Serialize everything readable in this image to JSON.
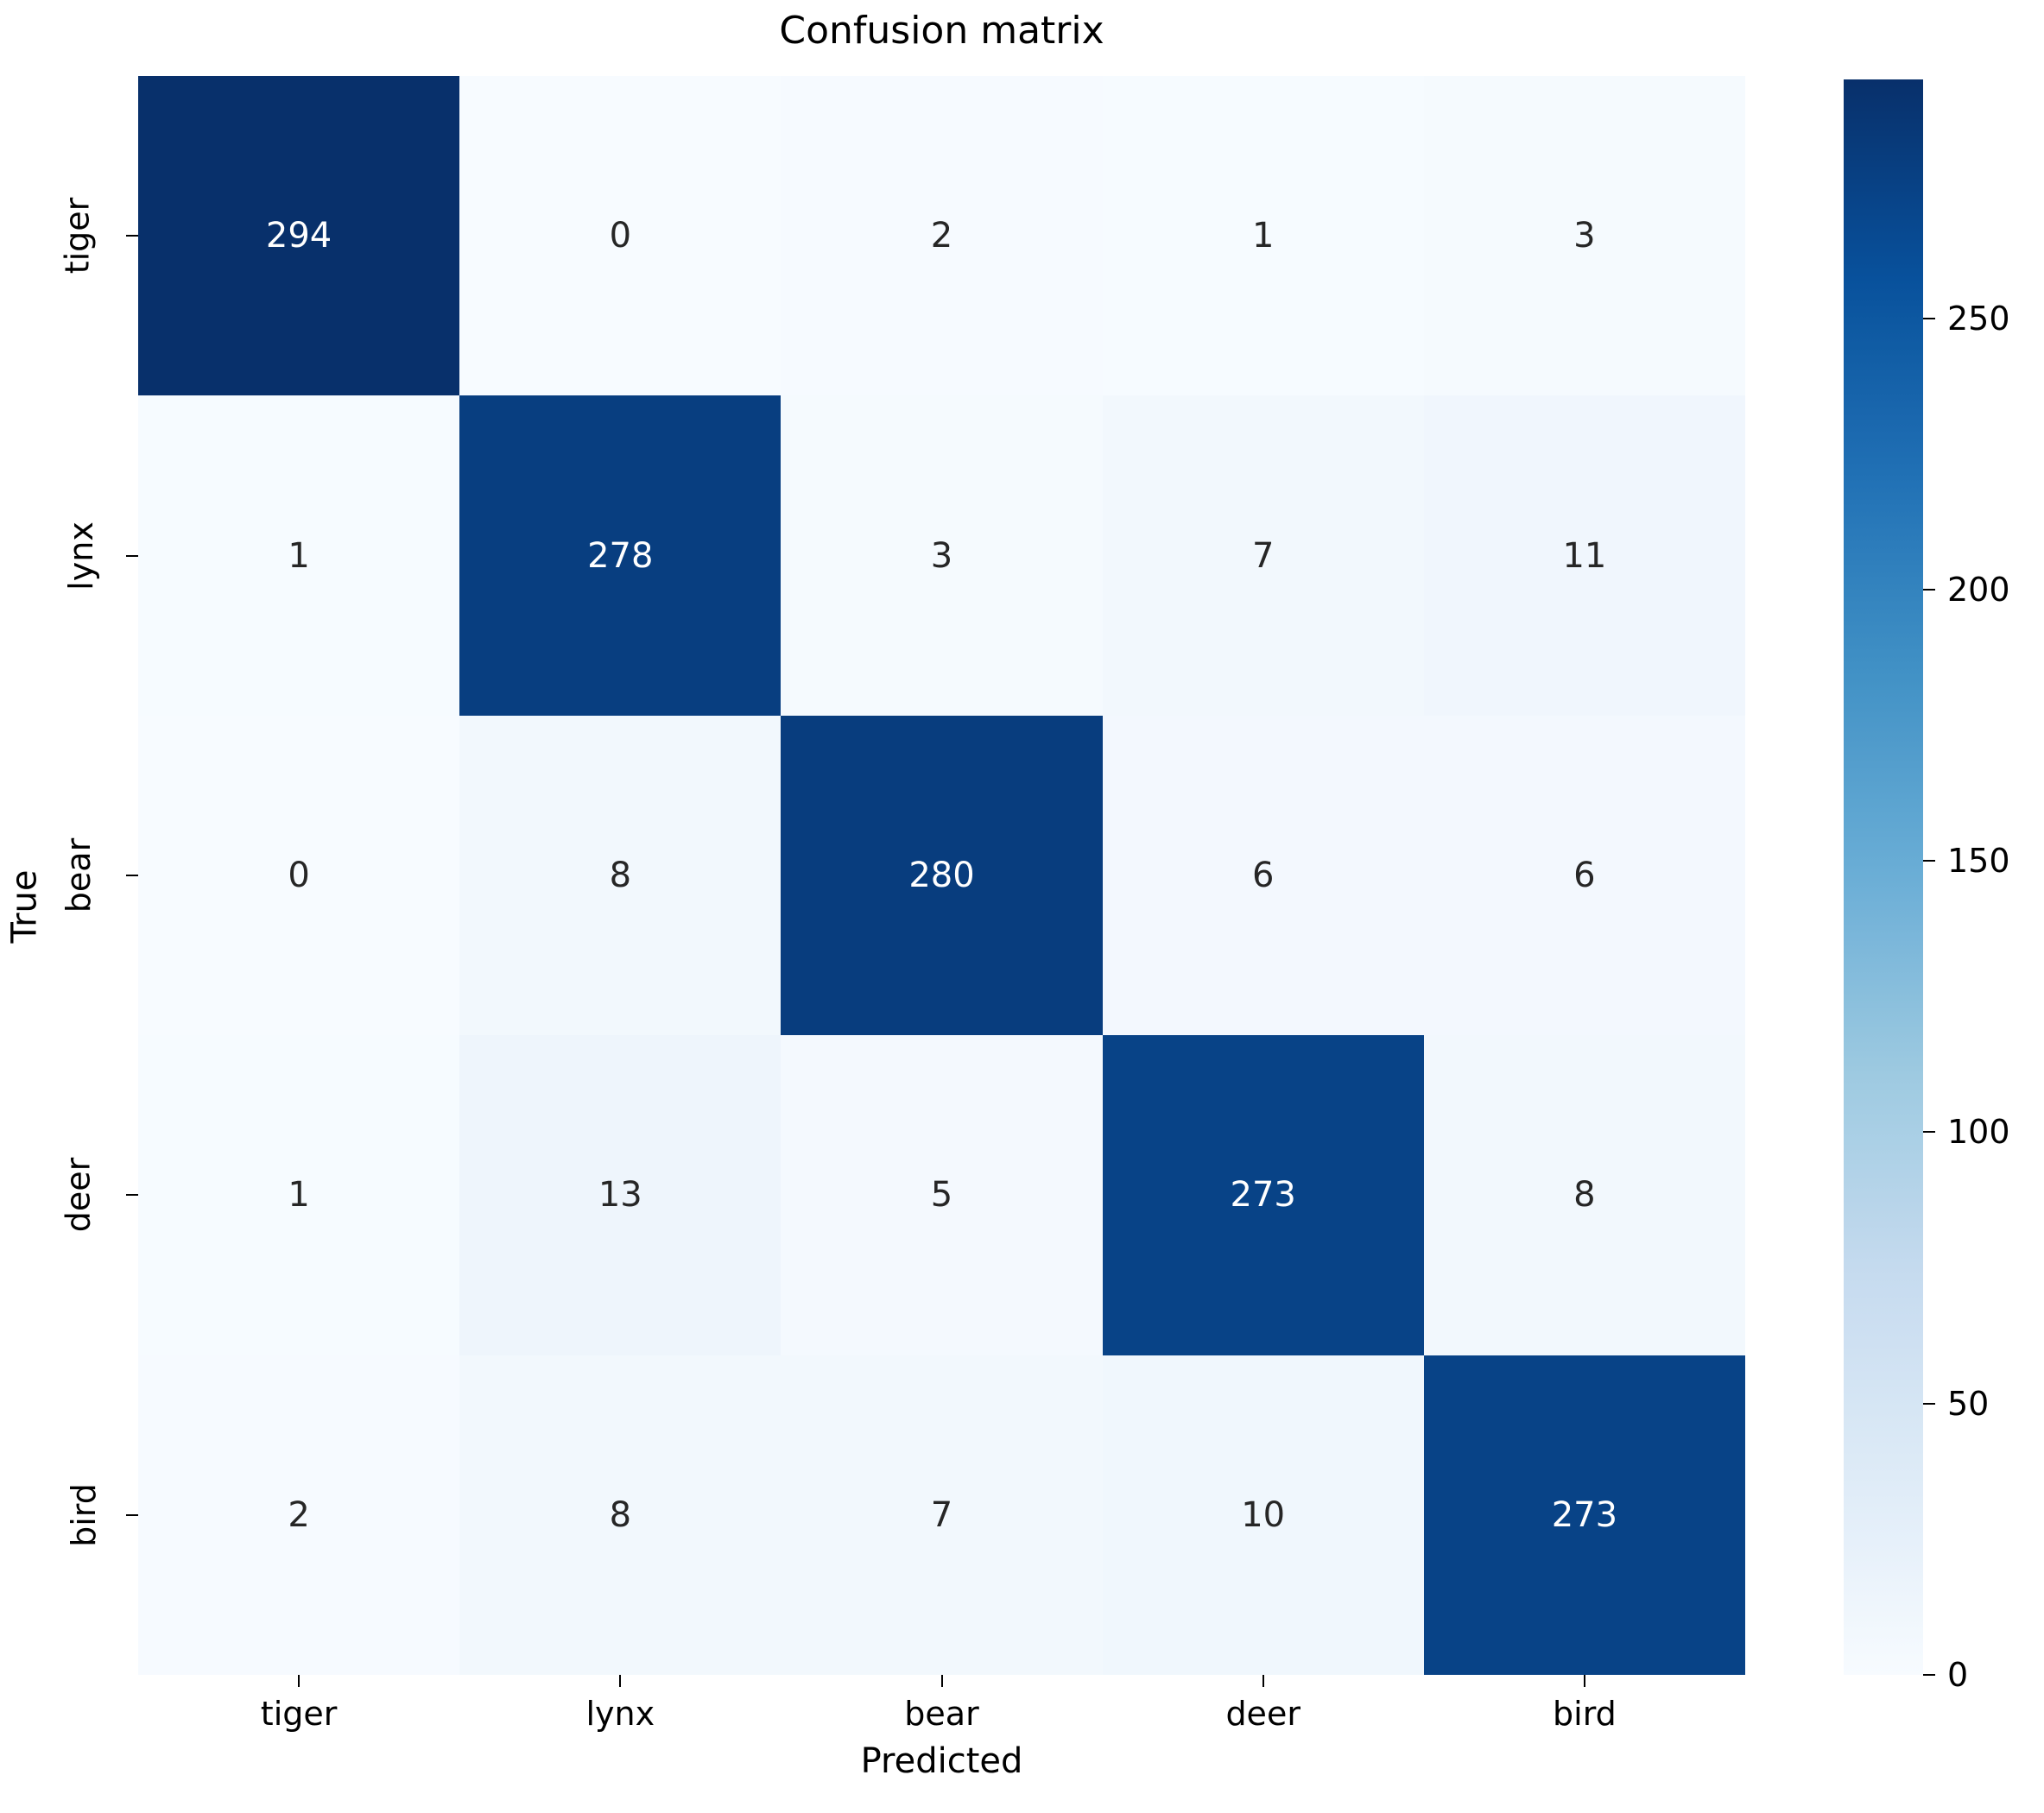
{
  "chart_data": {
    "type": "heatmap",
    "title": "Confusion matrix",
    "xlabel": "Predicted",
    "ylabel": "True",
    "x_categories": [
      "tiger",
      "lynx",
      "bear",
      "deer",
      "bird"
    ],
    "y_categories": [
      "tiger",
      "lynx",
      "bear",
      "deer",
      "bird"
    ],
    "values": [
      [
        294,
        0,
        2,
        1,
        3
      ],
      [
        1,
        278,
        3,
        7,
        11
      ],
      [
        0,
        8,
        280,
        6,
        6
      ],
      [
        1,
        13,
        5,
        273,
        8
      ],
      [
        2,
        8,
        7,
        10,
        273
      ]
    ],
    "rows": [
      {
        "label": "tiger",
        "cells": [
          294,
          0,
          2,
          1,
          3
        ]
      },
      {
        "label": "lynx",
        "cells": [
          1,
          278,
          3,
          7,
          11
        ]
      },
      {
        "label": "bear",
        "cells": [
          0,
          8,
          280,
          6,
          6
        ]
      },
      {
        "label": "deer",
        "cells": [
          1,
          13,
          5,
          273,
          8
        ]
      },
      {
        "label": "bird",
        "cells": [
          2,
          8,
          7,
          10,
          273
        ]
      }
    ],
    "colormap": "Blues",
    "vmin": 0,
    "vmax": 294,
    "colorbar": {
      "ticks": [
        0,
        50,
        100,
        150,
        200,
        250
      ],
      "tick_labels": [
        "0",
        "50",
        "100",
        "150",
        "200",
        "250"
      ],
      "position": "right",
      "min_color": "#f7fbff",
      "max_color": "#08306b"
    },
    "grid": false,
    "legend": "none",
    "annotation_text_color_light": "#ffffff",
    "annotation_text_color_dark": "#262626"
  }
}
